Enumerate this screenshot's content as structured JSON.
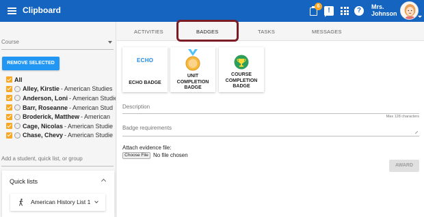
{
  "app": {
    "title": "Clipboard"
  },
  "header": {
    "notification_count": "6",
    "user_line1": "Mrs.",
    "user_line2": "Johnson",
    "icons": [
      "menu-icon",
      "clipboard-icon",
      "chat-alert-icon",
      "apps-grid-icon",
      "help-icon",
      "user-avatar"
    ]
  },
  "sidebar": {
    "course_placeholder": "Course",
    "remove_selected_label": "REMOVE SELECTED",
    "all_label": "All",
    "students": [
      {
        "name": "Alley, Kirstie",
        "course": "- American Studies"
      },
      {
        "name": "Anderson, Loni",
        "course": "- American Studie"
      },
      {
        "name": "Barr, Roseanne",
        "course": "- American Stud"
      },
      {
        "name": "Broderick, Matthew",
        "course": "- American"
      },
      {
        "name": "Cage, Nicolas",
        "course": "- American Studie"
      },
      {
        "name": "Chase, Chevy",
        "course": "- American Studie"
      }
    ],
    "quick_add_placeholder": "Add a student, quick list, or group",
    "quick_lists_title": "Quick lists",
    "quick_list_item": "American History List 1"
  },
  "tabs": {
    "activities": "ACTIVITIES",
    "badges": "BADGES",
    "tasks": "TASKS",
    "messages": "MESSAGES",
    "active": "BADGES"
  },
  "badges": {
    "echo_logo": "ECHO",
    "echo_label": "ECHO BADGE",
    "unit_line1": "UNIT",
    "unit_line2": "COMPLETION",
    "unit_line3": "BADGE",
    "course_line1": "COURSE",
    "course_line2": "COMPLETION",
    "course_line3": "BADGE"
  },
  "form": {
    "description_label": "Description",
    "max_chars": "Max 128 characters",
    "requirements_label": "Badge requirements",
    "attach_label": "Attach evidence file:",
    "choose_file_label": "Choose File",
    "no_file_text": "No file chosen",
    "award_label": "AWARD"
  },
  "colors": {
    "topbar": "#1565c0",
    "accent": "#2196f3",
    "checkbox": "#f9a825",
    "highlight": "#7b1c24"
  }
}
